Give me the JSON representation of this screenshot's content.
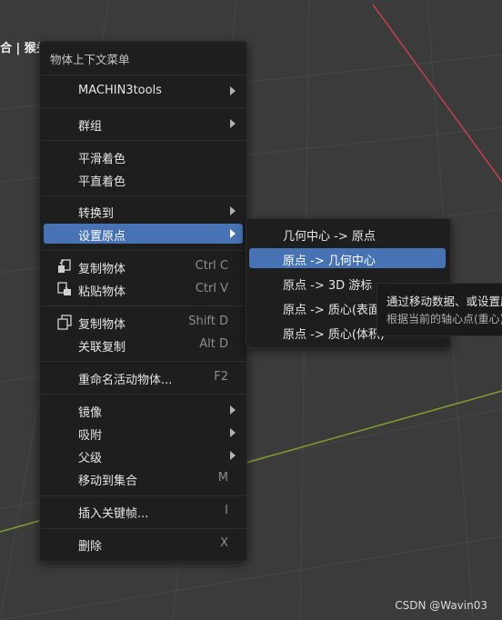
{
  "header": {
    "text": "合 | 猴头"
  },
  "menu": {
    "title": "物体上下文菜单",
    "items": [
      {
        "label": "MACHIN3tools",
        "shortcut": "",
        "submenu": true
      },
      {
        "label": "群组",
        "shortcut": "",
        "submenu": true
      },
      {
        "label": "平滑着色",
        "shortcut": ""
      },
      {
        "label": "平直着色",
        "shortcut": ""
      },
      {
        "label": "转换到",
        "shortcut": "",
        "submenu": true
      },
      {
        "label": "设置原点",
        "shortcut": "",
        "submenu": true,
        "active": true
      },
      {
        "label": "复制物体",
        "shortcut": "Ctrl C",
        "icon": "copy-icon"
      },
      {
        "label": "粘贴物体",
        "shortcut": "Ctrl V",
        "icon": "paste-icon"
      },
      {
        "label": "复制物体",
        "shortcut": "Shift D",
        "icon": "duplicate-icon"
      },
      {
        "label": "关联复制",
        "shortcut": "Alt D"
      },
      {
        "label": "重命名活动物体...",
        "shortcut": "F2"
      },
      {
        "label": "镜像",
        "shortcut": "",
        "submenu": true
      },
      {
        "label": "吸附",
        "shortcut": "",
        "submenu": true
      },
      {
        "label": "父级",
        "shortcut": "",
        "submenu": true
      },
      {
        "label": "移动到集合",
        "shortcut": "M"
      },
      {
        "label": "插入关键帧...",
        "shortcut": "I"
      },
      {
        "label": "删除",
        "shortcut": "X"
      }
    ]
  },
  "submenu": {
    "items": [
      {
        "label": "几何中心 -> 原点"
      },
      {
        "label": "原点 -> 几何中心",
        "active": true
      },
      {
        "label": "原点 -> 3D 游标"
      },
      {
        "label": "原点 -> 质心(表面)"
      },
      {
        "label": "原点 -> 质心(体积)"
      }
    ]
  },
  "tooltip": {
    "line1": "通过移动数据、或设置原点",
    "line2": "根据当前的轴心点(重心)"
  },
  "watermark": "CSDN @Wavin03",
  "colors": {
    "accent": "#4772b3",
    "menu_bg": "#1e1e1e",
    "x_axis": "#c0404f",
    "y_axis": "#7fa02e",
    "viewport_bg": "#3a3a3a"
  }
}
